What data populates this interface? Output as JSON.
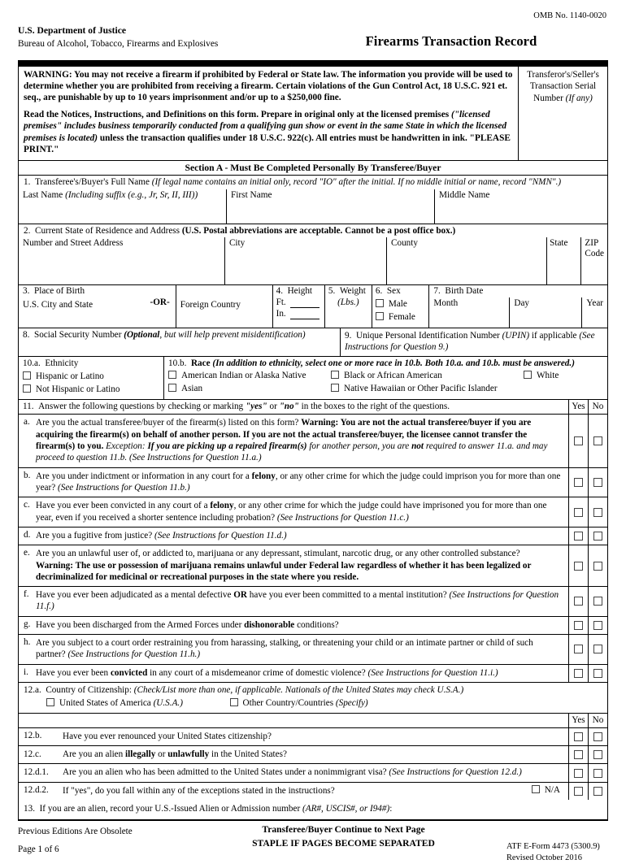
{
  "header": {
    "omb": "OMB No. 1140-0020",
    "agency_dept": "U.S. Department of Justice",
    "agency_bureau": "Bureau of Alcohol, Tobacco, Firearms and Explosives",
    "form_title": "Firearms Transaction Record"
  },
  "warning": {
    "paragraph1": "WARNING: You may not receive a firearm if prohibited by Federal or State law.  The information you provide will be used to determine whether you are prohibited from receiving a firearm.  Certain violations of the Gun Control Act, 18 U.S.C. 921 et. seq., are punishable by up to 10 years imprisonment and/or up to a $250,000 fine.",
    "paragraph2_a": "Read the Notices, Instructions, and Definitions on this form.  Prepare in original only at the licensed premises ",
    "paragraph2_b": "(\"licensed premises\" includes business temporarily conducted from a qualifying gun show or event in the same State in which the licensed premises is located)",
    "paragraph2_c": " unless the transaction qualifies under 18 U.S.C. 922(c).  All entries must be handwritten in ink.  \"PLEASE PRINT.\"",
    "serial_label": "Transferor's/Seller's Transaction Serial Number ",
    "serial_label_italic": "(If any)"
  },
  "section_a": {
    "title": "Section A - Must Be Completed Personally By Transferee/Buyer"
  },
  "q1": {
    "number": "1.",
    "label": "Transferee's/Buyer's Full Name ",
    "label_italic": "(If legal name contains an initial only, record \"IO\" after the initial.  If no middle initial or name, record \"NMN\".)",
    "last_name": "Last Name ",
    "last_name_italic": "(Including suffix (e.g., Jr, Sr, II, III))",
    "first_name": "First Name",
    "middle_name": "Middle Name"
  },
  "q2": {
    "number": "2.",
    "label": "Current State of Residence and Address ",
    "label_bold": "(U.S. Postal abbreviations are acceptable.  Cannot be a post office box.)",
    "street": "Number and Street Address",
    "city": "City",
    "county": "County",
    "state": "State",
    "zip": "ZIP Code"
  },
  "q3": {
    "number": "3.",
    "label": "Place of Birth",
    "us_city_state": "U.S. City and State",
    "or": "-OR-",
    "foreign_country": "Foreign Country"
  },
  "q4": {
    "number": "4.",
    "label": "Height",
    "ft": "Ft.",
    "in": "In."
  },
  "q5": {
    "number": "5.",
    "label": "Weight",
    "unit": "(Lbs.)"
  },
  "q6": {
    "number": "6.",
    "label": "Sex",
    "male": "Male",
    "female": "Female"
  },
  "q7": {
    "number": "7.",
    "label": "Birth Date",
    "month": "Month",
    "day": "Day",
    "year": "Year"
  },
  "q8": {
    "number": "8.",
    "label": "Social Security Number ",
    "optional_bold": "(Optional",
    "optional_italic": ", but will help prevent misidentification)"
  },
  "q9": {
    "number": "9.",
    "label": "Unique Personal Identification Number ",
    "upin_italic": "(UPIN)",
    "label2": " if applicable ",
    "see_italic": "(See Instructions for Question 9.)"
  },
  "q10a": {
    "number": "10.a.",
    "label": "Ethnicity",
    "options": [
      "Hispanic or Latino",
      "Not Hispanic or Latino"
    ]
  },
  "q10b": {
    "number": "10.b.",
    "label": "Race ",
    "label_italic": "(In addition to ethnicity, select one or more race in 10.b.  Both 10.a. and 10.b. must be answered.)",
    "col1": [
      "American Indian or Alaska Native",
      "Asian"
    ],
    "col2": [
      "Black or African American",
      "Native Hawaiian or Other Pacific Islander"
    ],
    "col3": [
      "White"
    ]
  },
  "q11": {
    "number": "11.",
    "header_a": "Answer the following questions by checking or marking ",
    "header_yes": "\"yes\"",
    "header_or": " or ",
    "header_no": "\"no\"",
    "header_b": " in the boxes to the right of the questions.",
    "yes": "Yes",
    "no": "No",
    "items": [
      {
        "letter": "a.",
        "parts": [
          {
            "t": "Are you the actual transferee/buyer of the firearm(s) listed on this form? ",
            "s": "n"
          },
          {
            "t": "Warning: You are not the actual transferee/buyer if you are acquiring the firearm(s) on behalf of another person.  If you are not the actual transferee/buyer, the licensee cannot transfer the firearm(s) to you.",
            "s": "b"
          },
          {
            "t": "  Exception:  ",
            "s": "i"
          },
          {
            "t": "If you are picking up a repaired firearm(s)",
            "s": "bi"
          },
          {
            "t": " for another person, you are ",
            "s": "i"
          },
          {
            "t": "not",
            "s": "bi"
          },
          {
            "t": " required to answer 11.a. and may proceed to question 11.b. (See Instructions for Question 11.a.)",
            "s": "i"
          }
        ]
      },
      {
        "letter": "b.",
        "parts": [
          {
            "t": "Are you under indictment or information in any court for a ",
            "s": "n"
          },
          {
            "t": "felony",
            "s": "b"
          },
          {
            "t": ", or any other crime for which the judge could imprison you for more than one year?  ",
            "s": "n"
          },
          {
            "t": "(See Instructions for Question 11.b.)",
            "s": "i"
          }
        ]
      },
      {
        "letter": "c.",
        "parts": [
          {
            "t": "Have you ever been convicted in any court of a ",
            "s": "n"
          },
          {
            "t": "felony",
            "s": "b"
          },
          {
            "t": ", or any other crime for which the judge could have imprisoned you for more than one year, even if you received a shorter sentence including probation?  ",
            "s": "n"
          },
          {
            "t": "(See Instructions for Question 11.c.)",
            "s": "i"
          }
        ]
      },
      {
        "letter": "d.",
        "parts": [
          {
            "t": "Are you a fugitive from justice? ",
            "s": "n"
          },
          {
            "t": "(See Instructions for Question 11.d.)",
            "s": "i"
          }
        ]
      },
      {
        "letter": "e.",
        "parts": [
          {
            "t": "Are you an unlawful user of, or addicted to, marijuana or any depressant, stimulant, narcotic drug, or any other controlled substance?",
            "s": "n"
          },
          {
            "t": "BR",
            "s": "br"
          },
          {
            "t": "Warning:  The use or possession of marijuana remains unlawful under Federal law regardless of whether it has been legalized or decriminalized for medicinal or recreational purposes in the state where you reside.",
            "s": "b"
          }
        ]
      },
      {
        "letter": "f.",
        "parts": [
          {
            "t": "Have you ever been adjudicated as a mental defective ",
            "s": "n"
          },
          {
            "t": "OR",
            "s": "b"
          },
          {
            "t": " have you ever been committed to a mental institution? ",
            "s": "n"
          },
          {
            "t": "(See Instructions for Question 11.f.)",
            "s": "i"
          }
        ]
      },
      {
        "letter": "g.",
        "parts": [
          {
            "t": "Have you been discharged from the Armed Forces under ",
            "s": "n"
          },
          {
            "t": "dishonorable",
            "s": "b"
          },
          {
            "t": " conditions?",
            "s": "n"
          }
        ]
      },
      {
        "letter": "h.",
        "parts": [
          {
            "t": "Are you subject to a court order restraining you from harassing, stalking, or threatening your child or an intimate partner or child of such partner? ",
            "s": "n"
          },
          {
            "t": "(See Instructions for Question 11.h.)",
            "s": "i"
          }
        ]
      },
      {
        "letter": "i.",
        "parts": [
          {
            "t": "Have you ever been ",
            "s": "n"
          },
          {
            "t": "convicted",
            "s": "b"
          },
          {
            "t": " in any court of a misdemeanor crime of domestic violence? ",
            "s": "n"
          },
          {
            "t": "(See Instructions for Question 11.i.)",
            "s": "i"
          }
        ]
      }
    ]
  },
  "q12a": {
    "number": "12.a.",
    "label": "Country of Citizenship:  ",
    "label_italic": "(Check/List more than one, if applicable.  Nationals of the United States may check U.S.A.)",
    "opt1": "United States of America ",
    "opt1_italic": "(U.S.A.)",
    "opt2": "Other Country/Countries ",
    "opt2_italic": "(Specify)"
  },
  "q12rows": {
    "yes": "Yes",
    "no": "No",
    "items": [
      {
        "number": "12.b.",
        "parts": [
          {
            "t": "Have you ever renounced your United States citizenship?",
            "s": "n"
          }
        ],
        "na": false
      },
      {
        "number": "12.c.",
        "parts": [
          {
            "t": "Are you an alien ",
            "s": "n"
          },
          {
            "t": "illegally",
            "s": "b"
          },
          {
            "t": " or ",
            "s": "n"
          },
          {
            "t": "unlawfully",
            "s": "b"
          },
          {
            "t": " in the United States?",
            "s": "n"
          }
        ],
        "na": false
      },
      {
        "number": "12.d.1.",
        "parts": [
          {
            "t": "Are you an alien who has been admitted to the United States under a nonimmigrant visa? ",
            "s": "n"
          },
          {
            "t": "(See Instructions for Question 12.d.)",
            "s": "i"
          }
        ],
        "na": false
      },
      {
        "number": "12.d.2.",
        "parts": [
          {
            "t": "If \"yes\", do you fall within any of the exceptions stated in the instructions?",
            "s": "n"
          }
        ],
        "na": true,
        "na_label": "N/A"
      }
    ]
  },
  "q13": {
    "number": "13.",
    "label": "If you are an alien, record your U.S.-Issued Alien or Admission number ",
    "label_italic": "(AR#, USCIS#, or I94#)",
    "colon": ":"
  },
  "footer": {
    "previous_editions": "Previous Editions Are Obsolete",
    "page": "Page 1 of 6",
    "continue": "Transferee/Buyer Continue to Next Page",
    "staple": "STAPLE IF PAGES BECOME SEPARATED",
    "form_id": "ATF E-Form 4473 (5300.9)",
    "revised": "Revised October 2016"
  }
}
